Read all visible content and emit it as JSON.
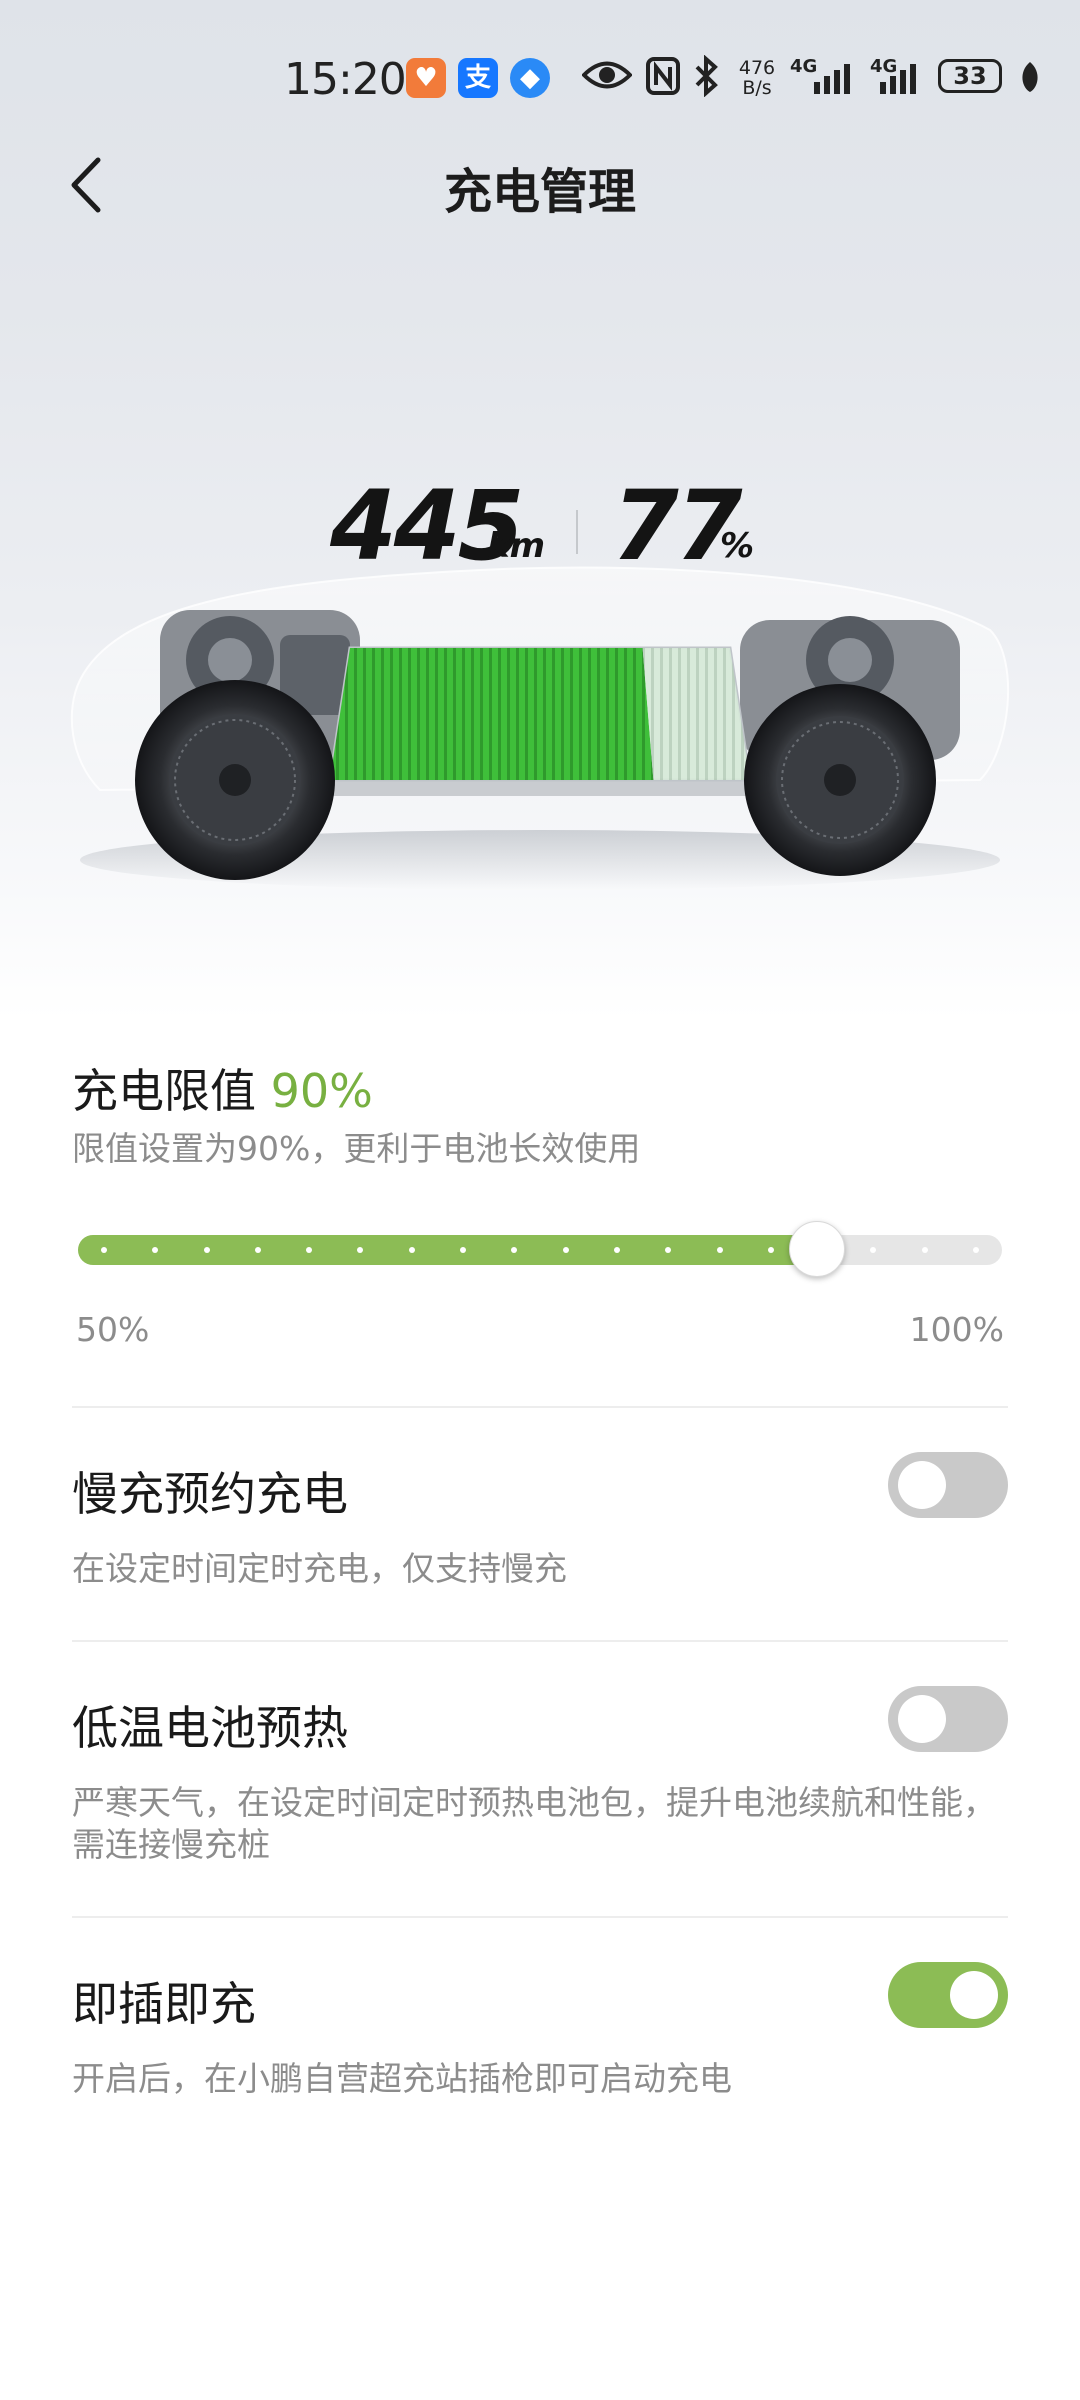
{
  "status_bar": {
    "time": "15:20",
    "app_icons": [
      "heart-app-icon",
      "alipay-icon",
      "browser-icon"
    ],
    "net_speed_value": "476",
    "net_speed_unit": "B/s",
    "signal1_label": "4G",
    "signal2_label": "4G",
    "battery_level": "33"
  },
  "header": {
    "back_icon": "chevron-left-icon",
    "title": "充电管理"
  },
  "vehicle": {
    "range_value": "445",
    "range_unit": "km",
    "soc_value": "77",
    "soc_unit": "%",
    "battery_fill_fraction": 0.77
  },
  "charge_limit": {
    "title_label": "充电限值",
    "value": "90%",
    "description": "限值设置为90%，更利于电池长效使用",
    "min_label": "50%",
    "max_label": "100%",
    "slider_min": 50,
    "slider_max": 100,
    "slider_value": 90
  },
  "settings": [
    {
      "title": "慢充预约充电",
      "description": "在设定时间定时充电，仅支持慢充",
      "enabled": false
    },
    {
      "title": "低温电池预热",
      "description": "严寒天气，在设定时间定时预热电池包，提升电池续航和性能，需连接慢充桩",
      "enabled": false
    },
    {
      "title": "即插即充",
      "description": "开启后，在小鹏自营超充站插枪即可启动充电",
      "enabled": true
    }
  ],
  "colors": {
    "accent_green": "#78b041",
    "toggle_on": "#8cbc55",
    "toggle_off": "#c9c9c9",
    "battery_green": "#3fbf3a"
  }
}
